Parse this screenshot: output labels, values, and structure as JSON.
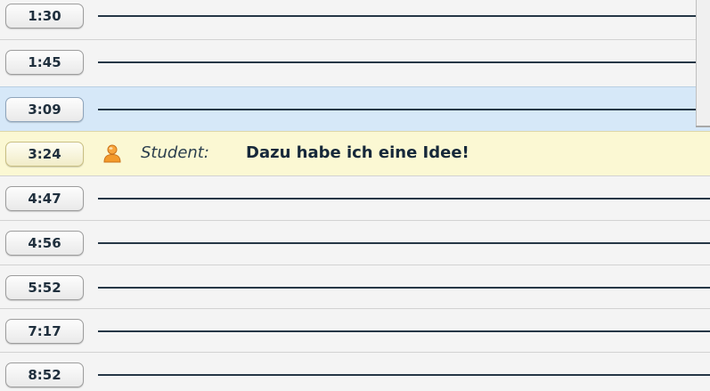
{
  "timeline": {
    "rows": [
      {
        "time": "1:30",
        "state": "normal"
      },
      {
        "time": "1:45",
        "state": "normal"
      },
      {
        "time": "3:09",
        "state": "selected"
      },
      {
        "time": "3:24",
        "state": "active",
        "speaker": "Student:",
        "message": "Dazu habe ich eine Idee!",
        "icon": "person-icon"
      },
      {
        "time": "4:47",
        "state": "normal"
      },
      {
        "time": "4:56",
        "state": "normal"
      },
      {
        "time": "5:52",
        "state": "normal"
      },
      {
        "time": "7:17",
        "state": "normal"
      },
      {
        "time": "8:52",
        "state": "normal"
      }
    ]
  },
  "colors": {
    "selected_row": "#d6e8f8",
    "active_row": "#fbf8d3",
    "line": "#263746",
    "person_icon": "#f39a2b"
  }
}
